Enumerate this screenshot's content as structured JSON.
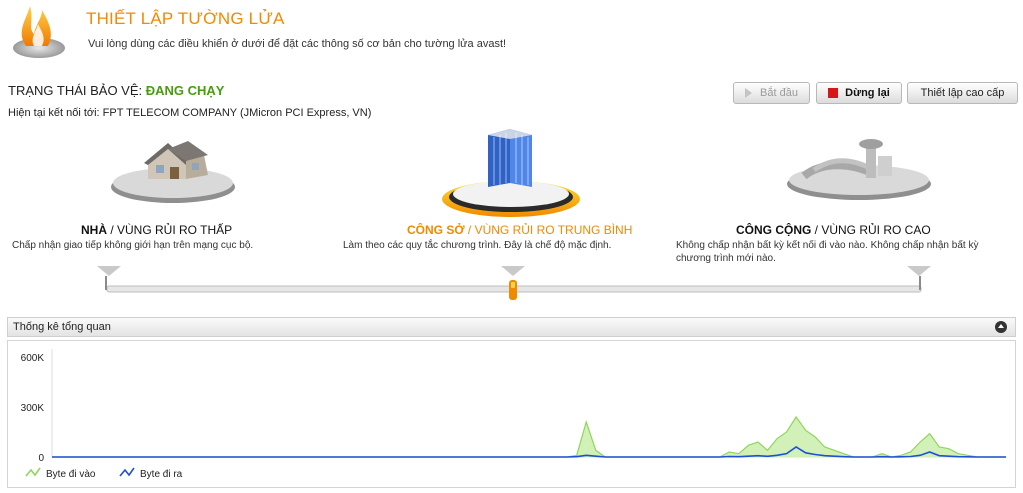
{
  "header": {
    "title": "THIẾT LẬP TƯỜNG LỬA",
    "subtitle": "Vui lòng dùng các điều khiển ở dưới để đặt các thông số cơ bản cho tường lửa avast!"
  },
  "status": {
    "label": "TRẠNG THÁI BẢO VỆ: ",
    "value": "ĐANG CHẠY",
    "connection": "Hiện tại kết nối tới:  FPT TELECOM COMPANY (JMicron PCI Express, VN)"
  },
  "toolbar": {
    "start_label": "Bắt đầu",
    "stop_label": "Dừng lại",
    "advanced_label": "Thiết lập cao cấp"
  },
  "zones": [
    {
      "name": "NHÀ",
      "risk": " / VÙNG RỦI RO THẤP",
      "desc": "Chấp nhận giao tiếp không giới hạn trên mạng cục bộ."
    },
    {
      "name": "CÔNG SỞ",
      "risk": " / VÙNG RỦI RO TRUNG BÌNH",
      "desc": "Làm theo các quy tắc chương trình. Đây là chế độ mặc định."
    },
    {
      "name": "CÔNG CỘNG",
      "risk": " / VÙNG RỦI RO CAO",
      "desc": "Không chấp nhận bất kỳ kết nối đi vào nào. Không chấp nhận bất kỳ chương trình mới nào."
    }
  ],
  "slider": {
    "selected_index": 1,
    "stops": 3
  },
  "stats": {
    "title": "Thống kê tổng quan"
  },
  "colors": {
    "accent": "#f08a00",
    "running": "#4a9a12",
    "incoming": "#8fd65a",
    "outgoing": "#1f4fd8"
  },
  "chart_data": {
    "type": "area",
    "title": "",
    "xlabel": "",
    "ylabel": "",
    "ylim": [
      0,
      600000
    ],
    "yticks": [
      {
        "value": 0,
        "label": "0"
      },
      {
        "value": 300000,
        "label": "300K"
      },
      {
        "value": 600000,
        "label": "600K"
      }
    ],
    "x": [
      0,
      54,
      55,
      56,
      57,
      58,
      59,
      60,
      61,
      62,
      63,
      64,
      65,
      66,
      67,
      68,
      69,
      70,
      71,
      72,
      73,
      74,
      75,
      76,
      77,
      78,
      79,
      80,
      81,
      82,
      83,
      84,
      85,
      86,
      87,
      88,
      89,
      90,
      91,
      92,
      93,
      94,
      95,
      96,
      97,
      98,
      99,
      100
    ],
    "series": [
      {
        "name": "Byte đi vào",
        "values": [
          0,
          0,
          10000,
          210000,
          40000,
          0,
          0,
          0,
          0,
          0,
          0,
          0,
          0,
          0,
          0,
          0,
          0,
          0,
          30000,
          20000,
          70000,
          90000,
          40000,
          110000,
          150000,
          240000,
          160000,
          120000,
          60000,
          40000,
          20000,
          0,
          0,
          0,
          20000,
          0,
          10000,
          30000,
          90000,
          140000,
          60000,
          50000,
          20000,
          10000,
          0,
          0,
          0,
          0
        ]
      },
      {
        "name": "Byte đi ra",
        "values": [
          0,
          0,
          2000,
          10000,
          5000,
          0,
          0,
          0,
          0,
          0,
          0,
          0,
          0,
          0,
          0,
          0,
          0,
          0,
          3000,
          2000,
          5000,
          8000,
          4000,
          10000,
          20000,
          60000,
          25000,
          15000,
          8000,
          5000,
          2000,
          0,
          0,
          0,
          2000,
          0,
          1000,
          3000,
          10000,
          30000,
          8000,
          5000,
          2000,
          1000,
          0,
          0,
          0,
          0
        ]
      }
    ],
    "legend": "bottom-left",
    "grid": false
  }
}
